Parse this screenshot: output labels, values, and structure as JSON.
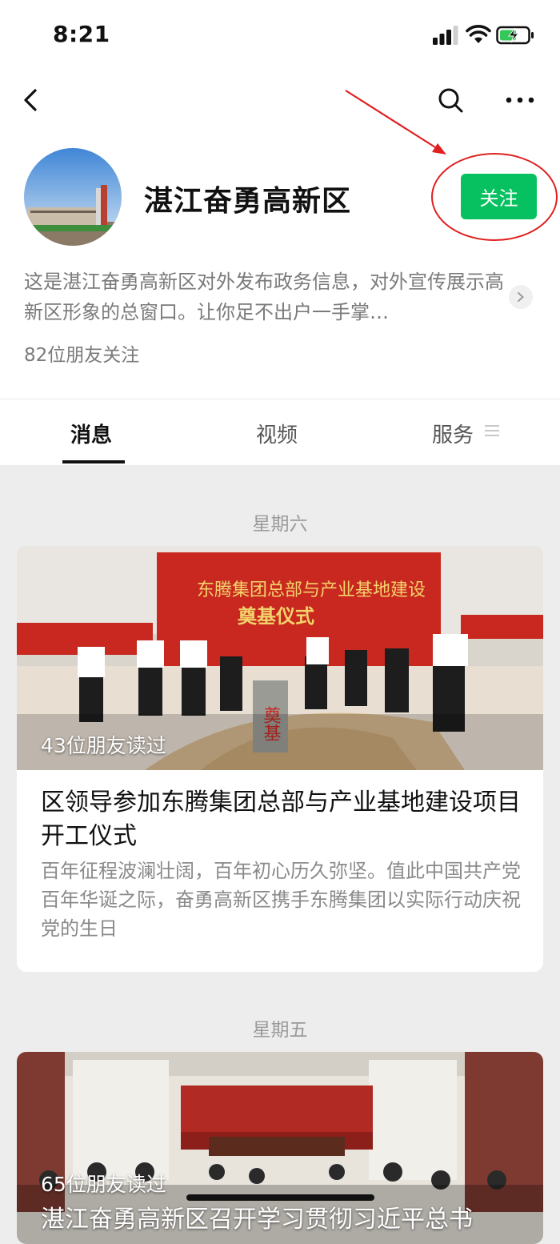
{
  "status_bar": {
    "time": "8:21"
  },
  "account": {
    "name": "湛江奋勇高新区",
    "follow_label": "关注",
    "description": "这是湛江奋勇高新区对外发布政务信息，对外宣传展示高新区形象的总窗口。让你足不出户一手掌…",
    "followers": "82位朋友关注"
  },
  "tabs": [
    {
      "label": "消息"
    },
    {
      "label": "视频"
    },
    {
      "label": "服务"
    }
  ],
  "feed": [
    {
      "day": "星期六",
      "read_count": "43位朋友读过",
      "banner_text": "东腾集团总部与产业基地建设",
      "banner_subtitle": "奠基仪式",
      "stone_text": "奠基",
      "title": "区领导参加东腾集团总部与产业基地建设项目开工仪式",
      "summary": "百年征程波澜壮阔，百年初心历久弥坚。值此中国共产党百年华诞之际，奋勇高新区携手东腾集团以实际行动庆祝党的生日"
    },
    {
      "day": "星期五",
      "read_count": "65位朋友读过",
      "title": "湛江奋勇高新区召开学习贯彻习近平总书"
    }
  ],
  "colors": {
    "follow_green": "#07c160",
    "annotation_red": "#e02020"
  }
}
